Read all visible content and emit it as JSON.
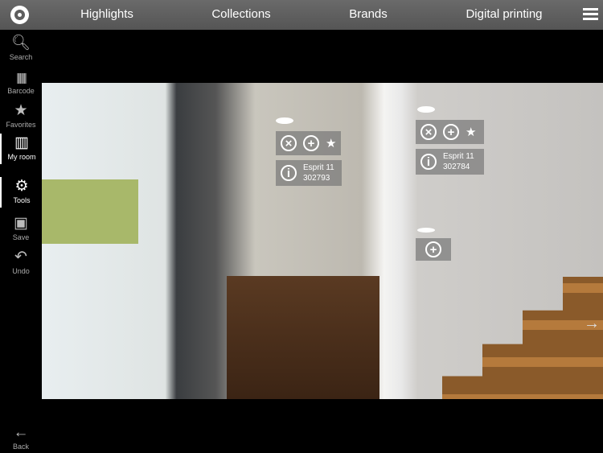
{
  "topbar": {
    "nav": [
      "Highlights",
      "Collections",
      "Brands",
      "Digital printing"
    ]
  },
  "sidebar": {
    "items": [
      {
        "label": "Search",
        "icon": "search-icon"
      },
      {
        "label": "Barcode",
        "icon": "barcode-icon"
      },
      {
        "label": "Favorites",
        "icon": "star-icon"
      },
      {
        "label": "My room",
        "icon": "room-icon",
        "active": true
      },
      {
        "label": "Tools",
        "icon": "gear-icon",
        "active": true
      },
      {
        "label": "Save",
        "icon": "floppy-icon"
      },
      {
        "label": "Undo",
        "icon": "undo-icon"
      }
    ],
    "back": "Back"
  },
  "overlays": [
    {
      "name": "Esprit 11",
      "code": "302793"
    },
    {
      "name": "Esprit 11",
      "code": "302784"
    }
  ]
}
